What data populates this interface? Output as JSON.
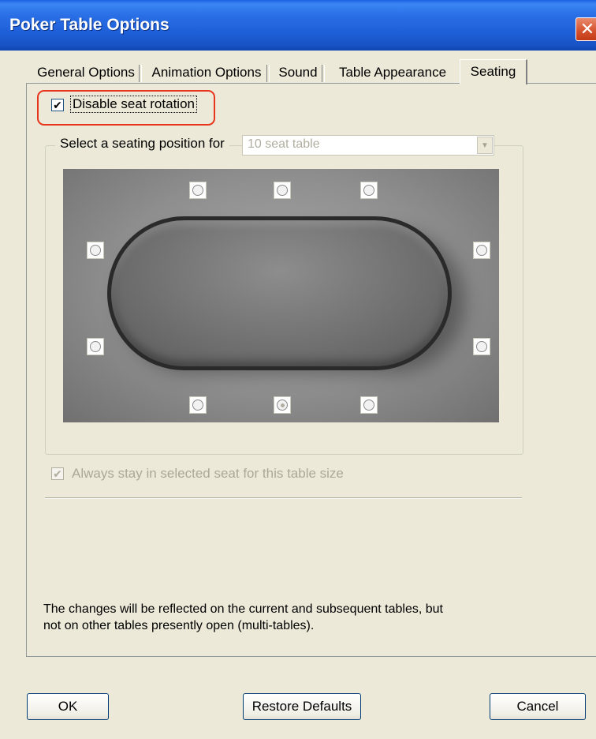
{
  "window": {
    "title": "Poker Table Options",
    "close_icon": "close-icon"
  },
  "tabs": [
    {
      "label": "General Options",
      "active": false
    },
    {
      "label": "Animation Options",
      "active": false
    },
    {
      "label": "Sound",
      "active": false
    },
    {
      "label": "Table Appearance",
      "active": false
    },
    {
      "label": "Seating",
      "active": true
    }
  ],
  "seating": {
    "disable_rotation": {
      "label": "Disable seat rotation",
      "checked": true
    },
    "select_label": "Select a seating position for",
    "table_size": {
      "value": "10 seat table",
      "enabled": false
    },
    "seats": [
      {
        "id": 1,
        "selected": false
      },
      {
        "id": 2,
        "selected": false
      },
      {
        "id": 3,
        "selected": false
      },
      {
        "id": 4,
        "selected": false
      },
      {
        "id": 5,
        "selected": false
      },
      {
        "id": 6,
        "selected": false
      },
      {
        "id": 7,
        "selected": true
      },
      {
        "id": 8,
        "selected": false
      },
      {
        "id": 9,
        "selected": false
      },
      {
        "id": 10,
        "selected": false
      }
    ],
    "always_stay": {
      "label": "Always stay in selected seat for this table size",
      "checked": true,
      "enabled": false
    }
  },
  "note": {
    "line1": "The changes will be reflected on the current and subsequent tables, but",
    "line2": "not on other tables presently open (multi-tables)."
  },
  "buttons": {
    "ok": "OK",
    "restore": "Restore Defaults",
    "cancel": "Cancel"
  },
  "colors": {
    "titlebar": "#2a6fe6",
    "dialog_bg": "#ece9d8",
    "highlight": "#e8341c"
  }
}
